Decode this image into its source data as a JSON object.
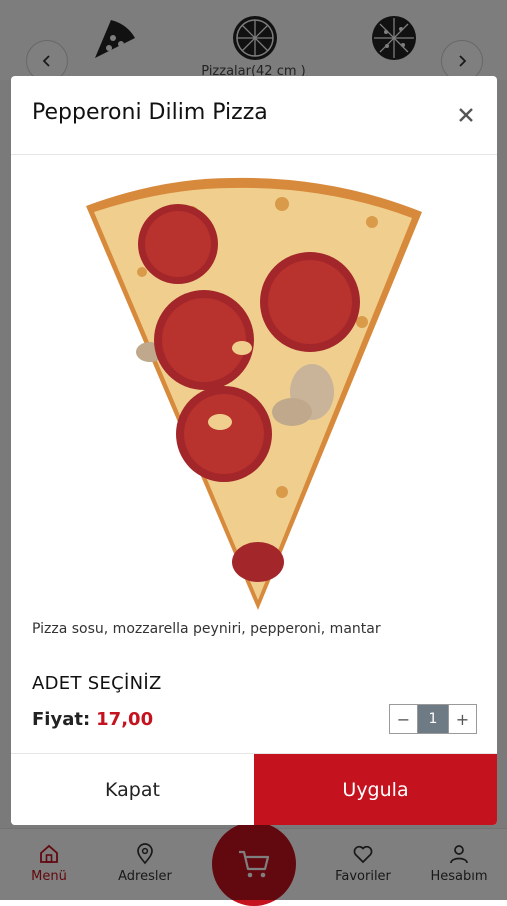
{
  "background": {
    "category_label": "Pizzalar(42 cm )",
    "bottom_nav": {
      "menu": "Menü",
      "addresses": "Adresler",
      "favorites": "Favoriler",
      "account": "Hesabım"
    }
  },
  "modal": {
    "title": "Pepperoni Dilim Pizza",
    "description": "Pizza sosu, mozzarella peyniri, pepperoni, mantar",
    "quantity_heading": "ADET SEÇİNİZ",
    "price_label": "Fiyat:",
    "price_value": "17,00",
    "quantity": "1",
    "minus_symbol": "−",
    "plus_symbol": "+",
    "close_label": "Kapat",
    "apply_label": "Uygula"
  },
  "colors": {
    "accent": "#c4121f",
    "overlay": "rgba(0,0,0,0.5)",
    "stepper_value_bg": "#6f7b84"
  },
  "icons": {
    "close": "close-icon",
    "prev": "chevron-left-icon",
    "next": "chevron-right-icon",
    "home": "home-icon",
    "location": "location-pin-icon",
    "cart": "cart-icon",
    "heart": "heart-icon",
    "user": "user-icon"
  }
}
